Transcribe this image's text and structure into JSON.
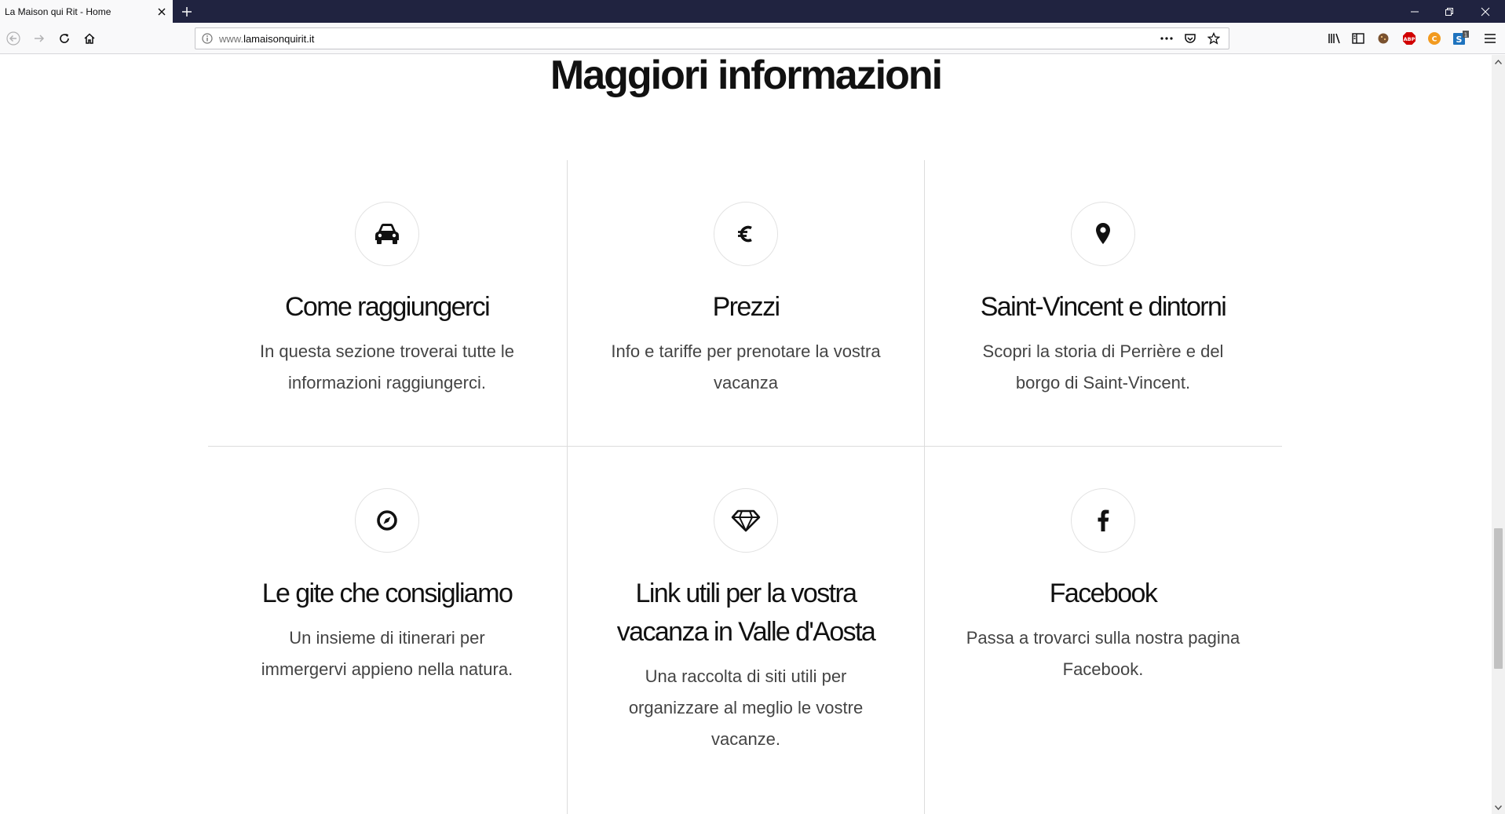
{
  "browser": {
    "tab_title": "La Maison qui Rit - Home",
    "url_domain": "www.",
    "url_host": "lamaisonquirit.it",
    "url_tld": "",
    "extension_badge": "1"
  },
  "section": {
    "title": "Maggiori informazioni"
  },
  "cards": [
    {
      "icon": "car-icon",
      "title": "Come raggiungerci",
      "desc_line1": "In questa sezione troverai tutte le",
      "desc_line2": "informazioni raggiungerci.",
      "desc_line3": ""
    },
    {
      "icon": "euro-icon",
      "title": "Prezzi",
      "desc_line1": "Info e tariffe per prenotare la vostra",
      "desc_line2": "vacanza",
      "desc_line3": ""
    },
    {
      "icon": "map-pin-icon",
      "title": "Saint-Vincent e dintorni",
      "desc_line1": "Scopri la storia di Perrière e del",
      "desc_line2": "borgo di Saint-Vincent.",
      "desc_line3": ""
    },
    {
      "icon": "compass-icon",
      "title": "Le gite che consigliamo",
      "desc_line1": "Un insieme di itinerari per",
      "desc_line2": "immergervi appieno nella natura.",
      "desc_line3": ""
    },
    {
      "icon": "diamond-icon",
      "title_line1": "Link utili per la vostra",
      "title_line2": "vacanza in Valle d'Aosta",
      "desc_line1": "Una raccolta di siti utili per",
      "desc_line2": "organizzare al meglio le vostre",
      "desc_line3": "vacanze."
    },
    {
      "icon": "facebook-icon",
      "title": "Facebook",
      "desc_line1": "Passa a trovarci sulla nostra pagina",
      "desc_line2": "Facebook.",
      "desc_line3": ""
    }
  ],
  "colors": {
    "tabstrip": "#202340",
    "toolbar": "#f9f9fa",
    "grid_line": "#dcdcdc",
    "text": "#111111"
  }
}
